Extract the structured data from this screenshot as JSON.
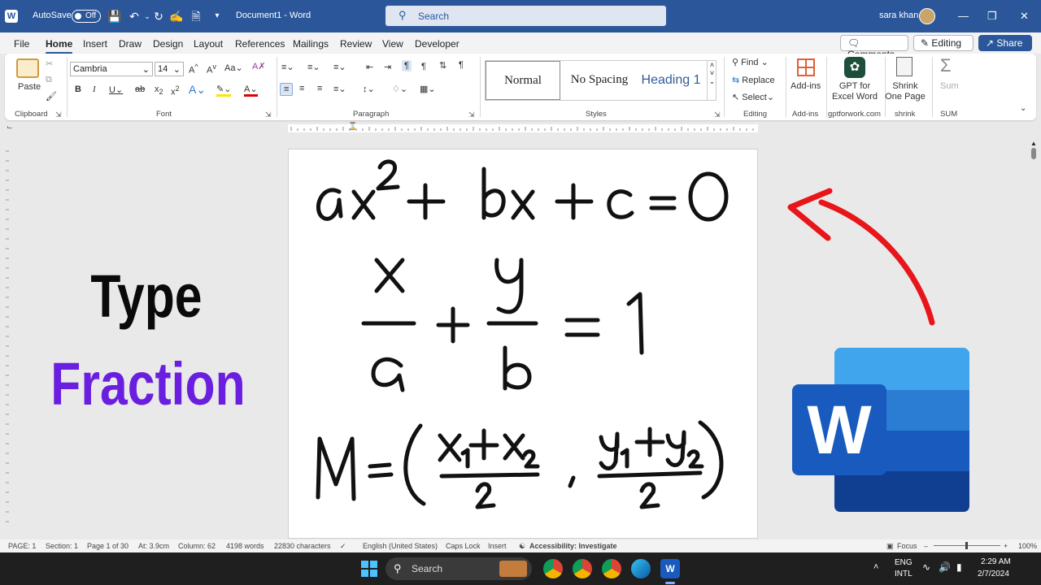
{
  "title_bar": {
    "autosave_label": "AutoSave",
    "autosave_state": "Off",
    "document_title": "Document1 - Word",
    "search_placeholder": "Search",
    "user_name": "sara khan"
  },
  "tabs": [
    "File",
    "Home",
    "Insert",
    "Draw",
    "Design",
    "Layout",
    "References",
    "Mailings",
    "Review",
    "View",
    "Developer"
  ],
  "top_buttons": {
    "comments": "Comments",
    "editing": "Editing",
    "share": "Share"
  },
  "ribbon": {
    "clipboard": {
      "paste": "Paste",
      "group": "Clipboard"
    },
    "font": {
      "name": "Cambria",
      "size": "14",
      "group": "Font"
    },
    "paragraph": {
      "group": "Paragraph"
    },
    "styles": {
      "normal": "Normal",
      "no_spacing": "No Spacing",
      "heading1": "Heading 1",
      "group": "Styles"
    },
    "editing": {
      "find": "Find",
      "replace": "Replace",
      "select": "Select",
      "group": "Editing"
    },
    "addins": {
      "addins": "Add-ins",
      "group": "Add-ins"
    },
    "gpt": {
      "line1": "GPT for",
      "line2": "Excel Word",
      "group": "gptforwork.com"
    },
    "shrink": {
      "line1": "Shrink",
      "line2": "One Page",
      "group": "shrink"
    },
    "sum": {
      "label": "Sum",
      "group": "SUM"
    }
  },
  "overlay": {
    "line1": "Type",
    "line2": "Fraction"
  },
  "status_bar": {
    "page": "PAGE: 1",
    "section": "Section: 1",
    "page_of": "Page 1 of 30",
    "at": "At: 3.9cm",
    "column": "Column: 62",
    "words": "4198 words",
    "characters": "22830 characters",
    "language": "English (United States)",
    "caps": "Caps Lock",
    "insert": "Insert",
    "accessibility": "Accessibility: Investigate",
    "focus": "Focus",
    "zoom": "100%"
  },
  "taskbar": {
    "search": "Search",
    "lang1": "ENG",
    "lang2": "INTL",
    "time": "2:29 AM",
    "date": "2/7/2024"
  },
  "colors": {
    "word_blue": "#2b579a",
    "accent_purple": "#6a1fe0",
    "arrow_red": "#e8151b"
  }
}
